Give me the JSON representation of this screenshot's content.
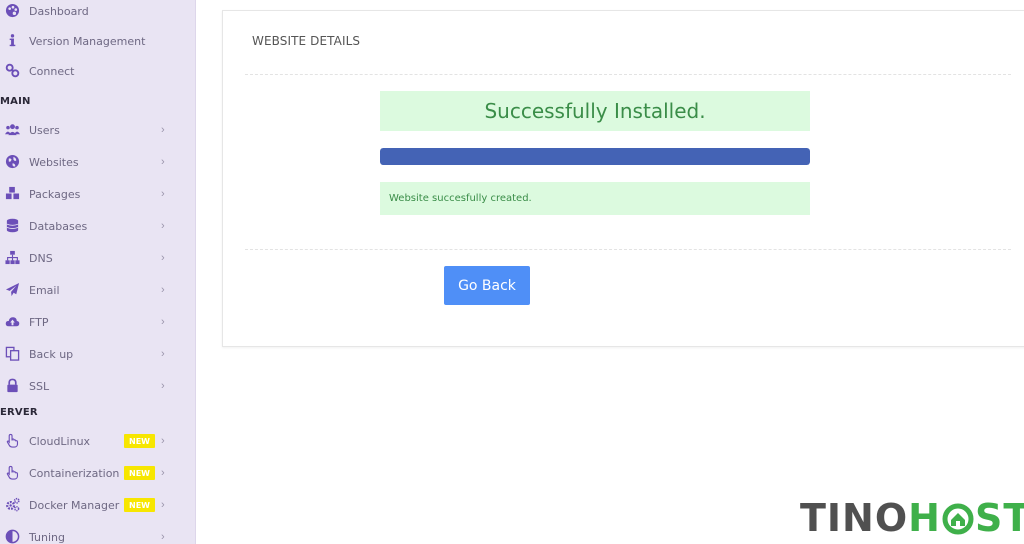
{
  "sidebar": {
    "top_items": [
      {
        "id": "dashboard",
        "label": "Dashboard",
        "icon": "palette-icon"
      },
      {
        "id": "version-management",
        "label": "Version Management",
        "icon": "info-icon"
      },
      {
        "id": "connect",
        "label": "Connect",
        "icon": "link-icon"
      }
    ],
    "sections": {
      "main": "MAIN",
      "server": "ERVER"
    },
    "main_items": [
      {
        "id": "users",
        "label": "Users",
        "icon": "users-icon"
      },
      {
        "id": "websites",
        "label": "Websites",
        "icon": "globe-icon"
      },
      {
        "id": "packages",
        "label": "Packages",
        "icon": "cubes-icon"
      },
      {
        "id": "databases",
        "label": "Databases",
        "icon": "database-icon"
      },
      {
        "id": "dns",
        "label": "DNS",
        "icon": "sitemap-icon"
      },
      {
        "id": "email",
        "label": "Email",
        "icon": "paper-plane-icon"
      },
      {
        "id": "ftp",
        "label": "FTP",
        "icon": "cloud-upload-icon"
      },
      {
        "id": "backup",
        "label": "Back up",
        "icon": "copy-icon"
      },
      {
        "id": "ssl",
        "label": "SSL",
        "icon": "lock-icon"
      }
    ],
    "server_items": [
      {
        "id": "cloudlinux",
        "label": "CloudLinux",
        "icon": "hand-pointer-icon",
        "badge": "NEW"
      },
      {
        "id": "containerization",
        "label": "Containerization",
        "icon": "hand-pointer-icon",
        "badge": "NEW"
      },
      {
        "id": "docker-manager",
        "label": "Docker Manager",
        "icon": "cogs-icon",
        "badge": "NEW"
      },
      {
        "id": "tuning",
        "label": "Tuning",
        "icon": "adjust-icon"
      }
    ],
    "chevron": "›"
  },
  "card": {
    "title": "WEBSITE DETAILS",
    "success_message": "Successfully Installed.",
    "progress_fraction": 1.0,
    "status_message": "Website succesfully created.",
    "go_back_label": "Go Back"
  },
  "watermark": {
    "part1": "TINO",
    "part2a": "H",
    "part2b": "ST"
  },
  "colors": {
    "sidebar_bg": "#e9e4f3",
    "icon": "#6c4fb8",
    "success_bg": "#dcfadf",
    "success_text": "#3a8d48",
    "progress": "#4463b5",
    "button": "#4f8ff7",
    "badge": "#f7e600",
    "logo_gray": "#505050",
    "logo_green": "#3fb04a"
  }
}
